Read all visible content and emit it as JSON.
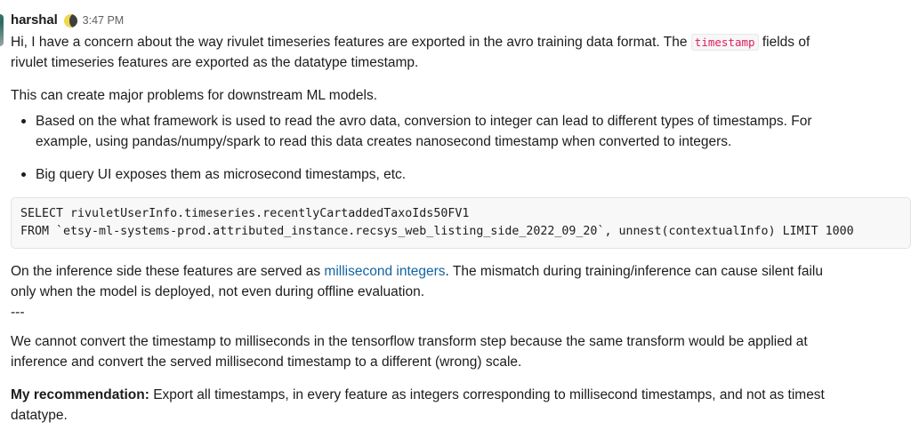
{
  "message": {
    "author": "harshal",
    "status_emoji": "moon-emoji",
    "timestamp": "3:47 PM",
    "avatar": "user-avatar",
    "paragraph1": {
      "line1_a": "Hi, I have a concern about the way rivulet timeseries features are exported in the avro training data format. The ",
      "code": "timestamp",
      "line1_b": " fields of",
      "line2": "rivulet timeseries features are exported as the datatype timestamp."
    },
    "paragraph2": "This can create major problems for downstream ML models.",
    "bullets": [
      {
        "line1": "Based on the what framework is used to read the avro data, conversion to integer can lead to different types of timestamps. For",
        "line2": "example, using pandas/numpy/spark to read this data creates nanosecond timestamp when converted to integers."
      },
      {
        "line1": "Big query UI exposes them as microsecond timestamps, etc.",
        "line2": ""
      }
    ],
    "code_block": {
      "line1": "SELECT rivuletUserInfo.timeseries.recentlyCartaddedTaxoIds50FV1",
      "line2": "FROM `etsy-ml-systems-prod.attributed_instance.recsys_web_listing_side_2022_09_20`, unnest(contextualInfo) LIMIT 1000"
    },
    "paragraph3": {
      "line1_a": "On the inference side these features are served as ",
      "link": "millisecond integers",
      "line1_b": ". The mismatch during training/inference can cause silent failu",
      "line2": "only when the model is deployed, not even during offline evaluation."
    },
    "divider_text": "---",
    "paragraph4": {
      "line1": "We cannot convert the timestamp to milliseconds in the tensorflow transform step because the same transform would be applied at",
      "line2": "inference and convert the served millisecond timestamp to a different (wrong) scale."
    },
    "paragraph5": {
      "label": "My recommendation:",
      "line1": " Export all timestamps, in every feature as integers corresponding to millisecond timestamps, and not as timest",
      "line2": "datatype."
    }
  },
  "colors": {
    "text": "#1d1c1d",
    "meta": "#616061",
    "inline_code": "#e01e5a",
    "link": "#1264a3",
    "code_bg": "#f8f8f8",
    "emoji_yellow": "#f2d74e"
  }
}
